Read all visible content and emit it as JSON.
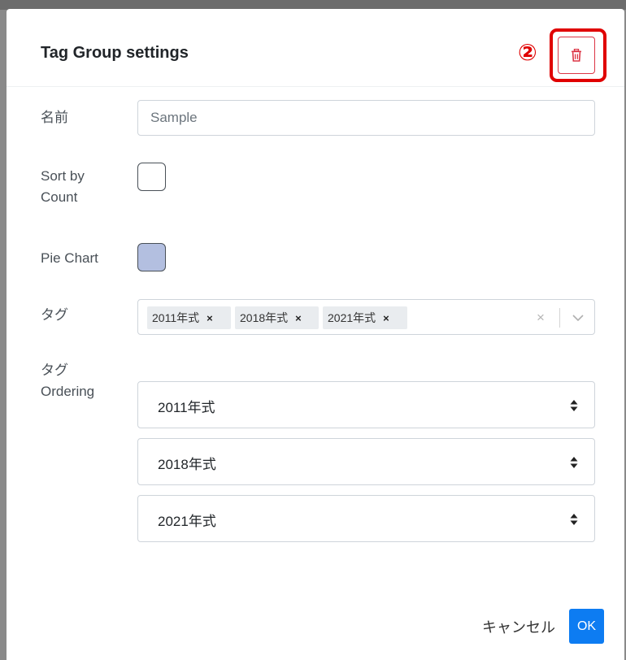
{
  "modal": {
    "title": "Tag Group settings",
    "annotation_marker": "②"
  },
  "form": {
    "name": {
      "label": "名前",
      "value": "Sample",
      "placeholder": ""
    },
    "sort_by_count": {
      "label": "Sort by\nCount",
      "checked": false
    },
    "pie_chart": {
      "label": "Pie Chart",
      "checked": true
    },
    "tags": {
      "label": "タグ",
      "selected": [
        "2011年式",
        "2018年式",
        "2021年式"
      ],
      "remove_glyph": "×",
      "clear_glyph": "×"
    },
    "tag_ordering": {
      "label": "タグ\nOrdering",
      "items": [
        "2011年式",
        "2018年式",
        "2021年式"
      ]
    }
  },
  "footer": {
    "cancel_label": "キャンセル",
    "ok_label": "OK"
  },
  "icons": {
    "delete": "trash-icon",
    "multiselect_open": "chevron-down-icon",
    "select_sort": "sort-arrows-icon"
  },
  "colors": {
    "danger": "#dc3545",
    "annotation": "#e00000",
    "primary": "#0d7cf2",
    "pie_chart_checkbox_fill": "#b3bfe0"
  }
}
